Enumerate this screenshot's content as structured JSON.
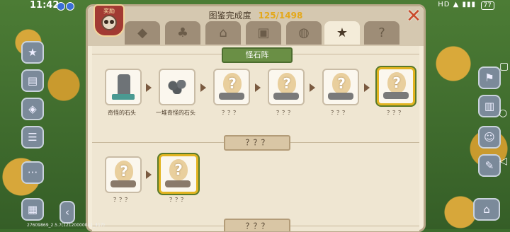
{
  "status": {
    "time": "11:42",
    "battery": "77",
    "notif1": "Ai",
    "notif2": "Ai",
    "signal": "HD ▲ ▮▮▮"
  },
  "panel": {
    "title": "图鉴完成度",
    "progress": "125/1498",
    "reward_label": "奖励",
    "close": "✕"
  },
  "tabs": [
    {
      "name": "diamond",
      "glyph": "◆"
    },
    {
      "name": "clover",
      "glyph": "♣"
    },
    {
      "name": "house",
      "glyph": "⌂"
    },
    {
      "name": "chest",
      "glyph": "▣"
    },
    {
      "name": "egg",
      "glyph": "◍"
    },
    {
      "name": "star",
      "glyph": "★"
    },
    {
      "name": "question",
      "glyph": "?"
    }
  ],
  "sections": {
    "first": {
      "label": "怪石阵"
    },
    "second": {
      "label": "？？？"
    },
    "third": {
      "label": "？？？"
    }
  },
  "row1": [
    {
      "caption": "奇怪的石头"
    },
    {
      "caption": "一堆奇怪的石头"
    },
    {
      "caption": "？？？"
    },
    {
      "caption": "？？？"
    },
    {
      "caption": "？？？"
    },
    {
      "caption": "？？？"
    }
  ],
  "row2": [
    {
      "caption": "？？？"
    },
    {
      "caption": "？？？"
    }
  ],
  "footer": "27609869_2.5.7(12120000041_417)"
}
